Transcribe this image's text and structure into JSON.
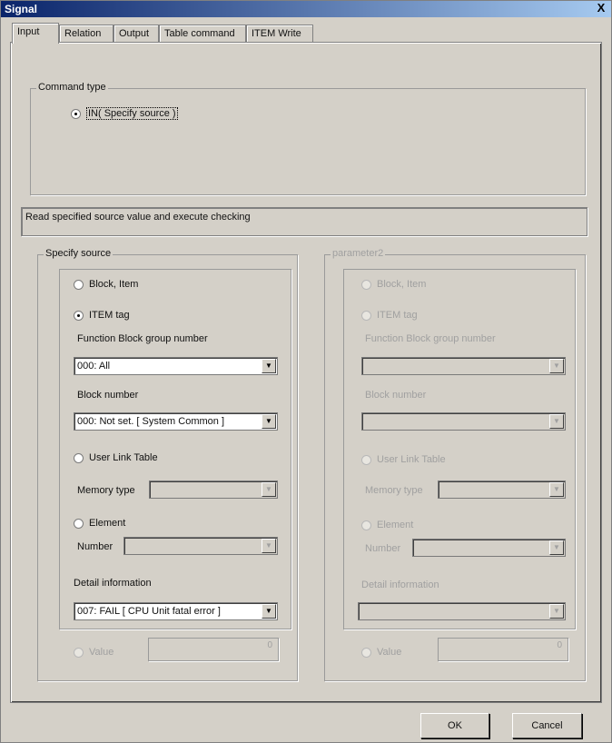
{
  "window": {
    "title": "Signal",
    "close_glyph": "X"
  },
  "tabs": [
    {
      "label": "Input",
      "active": true
    },
    {
      "label": "Relation",
      "active": false
    },
    {
      "label": "Output",
      "active": false
    },
    {
      "label": "Table command",
      "active": false
    },
    {
      "label": "ITEM Write",
      "active": false
    }
  ],
  "command_type": {
    "legend": "Command type",
    "option_label": "IN( Specify source )",
    "selected": true
  },
  "description": "Read specified source value and execute checking",
  "specify_source": {
    "legend": "Specify source",
    "block_item_label": "Block, Item",
    "item_tag_label": "ITEM tag",
    "item_tag_selected": true,
    "fb_group_label": "Function Block group number",
    "fb_group_value": "000: All",
    "block_number_label": "Block number",
    "block_number_value": "000: Not set. [ System Common ]",
    "user_link_label": "User Link Table",
    "memory_type_label": "Memory type",
    "element_label": "Element",
    "number_label": "Number",
    "detail_info_label": "Detail information",
    "detail_info_value": "007: FAIL [ CPU Unit fatal error ]",
    "value_label": "Value",
    "value_value": "0"
  },
  "parameter2": {
    "legend": "parameter2",
    "block_item_label": "Block, Item",
    "item_tag_label": "ITEM tag",
    "fb_group_label": "Function Block group number",
    "block_number_label": "Block number",
    "user_link_label": "User Link Table",
    "memory_type_label": "Memory type",
    "element_label": "Element",
    "number_label": "Number",
    "detail_info_label": "Detail information",
    "value_label": "Value",
    "value_value": "0"
  },
  "buttons": {
    "ok": "OK",
    "cancel": "Cancel"
  },
  "icons": {
    "dropdown": "chevron-down-icon",
    "radio": "radio-icon"
  }
}
